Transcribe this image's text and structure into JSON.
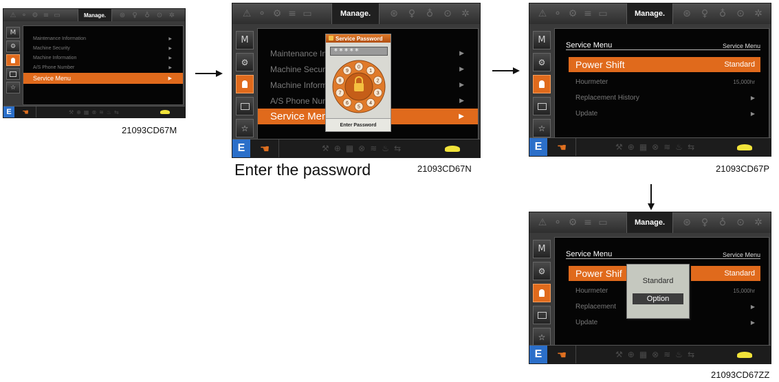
{
  "figures": {
    "m": {
      "caption": "21093CD67M",
      "top_title": "Manage."
    },
    "n": {
      "caption": "21093CD67N",
      "top_title": "Manage."
    },
    "p": {
      "caption": "21093CD67P",
      "top_title": "Manage."
    },
    "zz": {
      "caption": "21093CD67ZZ",
      "top_title": "Manage."
    }
  },
  "password_caption": "Enter the password",
  "sidebar": [
    "M",
    "⚙",
    "👤",
    "🗒",
    "☆"
  ],
  "bottom_bar": {
    "e_label": "E"
  },
  "manage_menu": [
    {
      "label": "Maintenance Information",
      "arrow": "▶"
    },
    {
      "label": "Machine Security",
      "arrow": "▶"
    },
    {
      "label": "Machine Information",
      "arrow": "▶"
    },
    {
      "label": "A/S Phone Number",
      "arrow": "▶"
    },
    {
      "label": "Service Menu",
      "arrow": "▶"
    }
  ],
  "manage_menu_truncated": [
    {
      "label": "Maintenance In",
      "arrow": "▶"
    },
    {
      "label": "Machine Secur",
      "arrow": "▶"
    },
    {
      "label": "Machine Inform",
      "arrow": "▶"
    },
    {
      "label": "A/S Phone Nur",
      "arrow": "▶"
    },
    {
      "label": "Service Men",
      "arrow": "▶"
    }
  ],
  "password_dialog": {
    "title": "Service Password",
    "masked_value": "*****",
    "dial_digits": [
      "0",
      "1",
      "2",
      "3",
      "4",
      "5",
      "6",
      "7",
      "8",
      "9"
    ],
    "enter_label": "Enter Password"
  },
  "service_menu": {
    "title": "Service Menu",
    "subtitle": "Service Menu",
    "items": [
      {
        "label": "Power Shift",
        "value": "Standard"
      },
      {
        "label": "Hourmeter",
        "value": "15,000hr"
      },
      {
        "label": "Replacement History",
        "value": "▶"
      },
      {
        "label": "Update",
        "value": "▶"
      }
    ],
    "items_truncated": [
      "Power Shif",
      "Hourmeter",
      "Replacement",
      "Update"
    ]
  },
  "popup": {
    "options": [
      "Standard",
      "Option"
    ],
    "selected": "Option"
  },
  "arrows": {
    "right": "→",
    "down": "↓"
  }
}
